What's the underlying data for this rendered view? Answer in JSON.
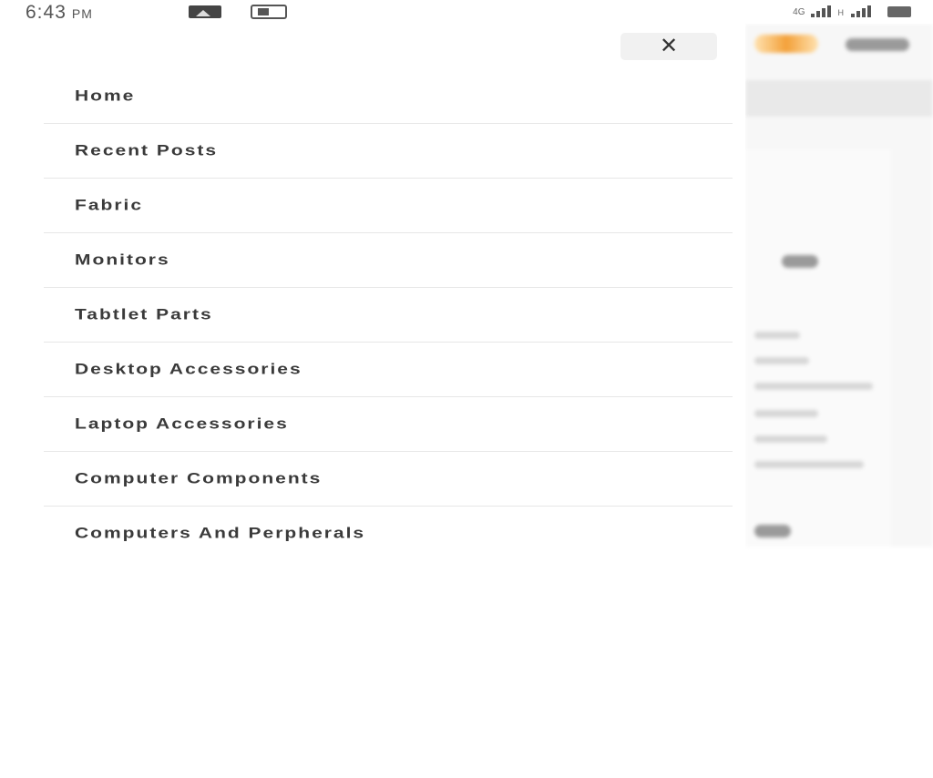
{
  "status_bar": {
    "time": "6:43",
    "ampm": "PM",
    "icons": [
      "gallery-icon",
      "app-notification-icon",
      "volte-icon",
      "signal-icon",
      "signal-icon",
      "battery-icon"
    ],
    "network_type": "H",
    "volte": "4G"
  },
  "drawer": {
    "close_icon": "✕",
    "menu": [
      {
        "label": "Home"
      },
      {
        "label": "Recent Posts"
      },
      {
        "label": "Fabric"
      },
      {
        "label": "Monitors"
      },
      {
        "label": "Tabtlet Parts"
      },
      {
        "label": "Desktop Accessories"
      },
      {
        "label": "Laptop Accessories"
      },
      {
        "label": "Computer Components"
      },
      {
        "label": "Computers And Perpherals"
      }
    ]
  },
  "colors": {
    "drawer_background": "#ffffff",
    "menu_text": "#3a3a3a",
    "divider": "#e7e7e7",
    "close_button_bg": "#f1f1f1",
    "brand_accent": "#f3a13a"
  }
}
